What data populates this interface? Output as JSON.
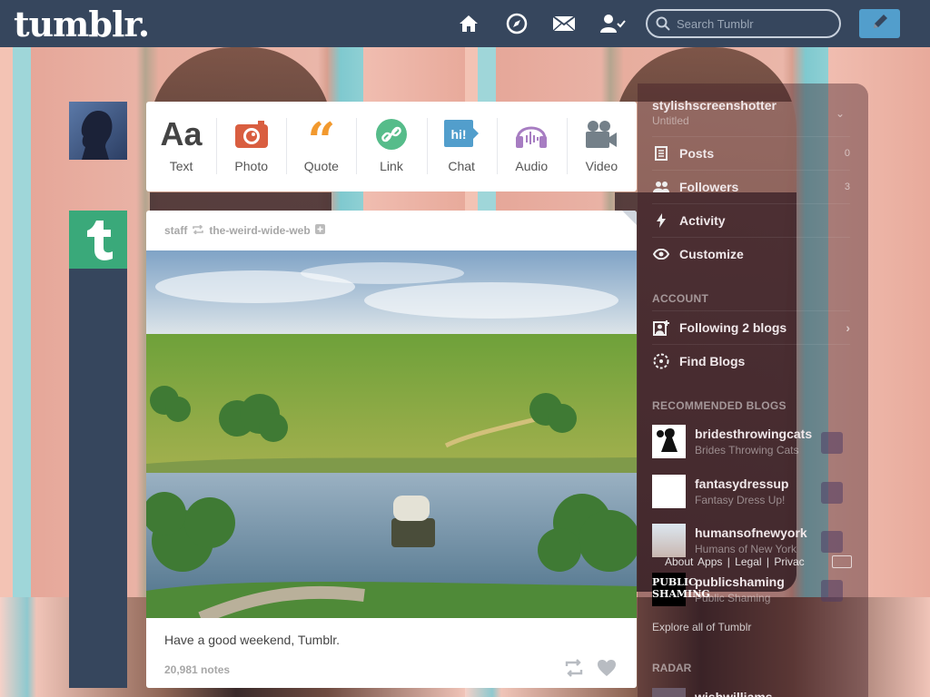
{
  "header": {
    "logo": "tumblr.",
    "search_placeholder": "Search Tumblr"
  },
  "icons": {
    "home": "home-icon",
    "explore": "compass-icon",
    "inbox": "mail-icon",
    "account": "user-icon",
    "compose": "pencil-icon"
  },
  "post_types": [
    {
      "label": "Text",
      "color": "#444444"
    },
    {
      "label": "Photo",
      "color": "#d95e40"
    },
    {
      "label": "Quote",
      "color": "#f2992e"
    },
    {
      "label": "Link",
      "color": "#56bc8a"
    },
    {
      "label": "Chat",
      "color": "#529ecc"
    },
    {
      "label": "Audio",
      "color": "#a77dc2"
    },
    {
      "label": "Video",
      "color": "#748089"
    }
  ],
  "post": {
    "author": "staff",
    "reblogged_from": "the-weird-wide-web",
    "caption": "Have a good weekend, Tumblr.",
    "notes": "20,981 notes"
  },
  "sidebar": {
    "blog_name": "stylishscreenshotter",
    "blog_title": "Untitled",
    "items": [
      {
        "label": "Posts",
        "count": "0"
      },
      {
        "label": "Followers",
        "count": "3"
      },
      {
        "label": "Activity",
        "count": ""
      },
      {
        "label": "Customize",
        "count": ""
      }
    ],
    "account_title": "ACCOUNT",
    "account_items": [
      {
        "label": "Following 2 blogs"
      },
      {
        "label": "Find Blogs"
      }
    ],
    "recommended_title": "RECOMMENDED BLOGS",
    "recommended": [
      {
        "name": "bridesthrowingcats",
        "title": "Brides Throwing Cats"
      },
      {
        "name": "fantasydressup",
        "title": "Fantasy Dress Up!"
      },
      {
        "name": "humansofnewyork",
        "title": "Humans of New York"
      },
      {
        "name": "publicshaming",
        "title": "Public Shaming"
      }
    ],
    "footer_links": "About   Apps  |  Legal  |  Privac",
    "explore": "Explore all of Tumblr",
    "radar_title": "RADAR",
    "radar_user": "wishwilliams",
    "public_logo": "PUBLIC SHAMING"
  }
}
